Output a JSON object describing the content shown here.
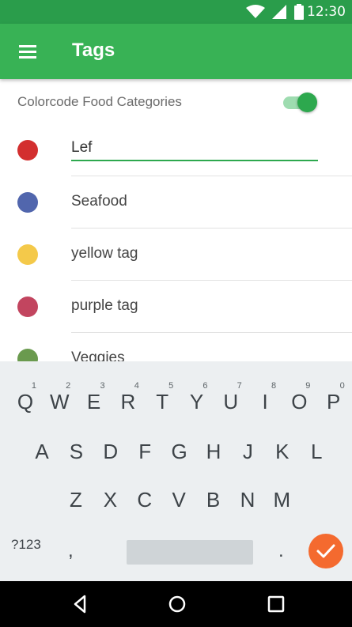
{
  "status_bar": {
    "time": "12:30"
  },
  "app_bar": {
    "title": "Tags"
  },
  "colorcode": {
    "label": "Colorcode Food Categories",
    "enabled": true
  },
  "tags": [
    {
      "name": "Lef",
      "color": "#d32f2f",
      "editing": true
    },
    {
      "name": "Seafood",
      "color": "#5166ad"
    },
    {
      "name": "yellow tag",
      "color": "#f4c94a"
    },
    {
      "name": "purple tag",
      "color": "#c2455f"
    },
    {
      "name": "Veggies",
      "color": "#6a9a4e"
    }
  ],
  "keyboard": {
    "row1": [
      {
        "key": "Q",
        "hint": "1"
      },
      {
        "key": "W",
        "hint": "2"
      },
      {
        "key": "E",
        "hint": "3"
      },
      {
        "key": "R",
        "hint": "4"
      },
      {
        "key": "T",
        "hint": "5"
      },
      {
        "key": "Y",
        "hint": "6"
      },
      {
        "key": "U",
        "hint": "7"
      },
      {
        "key": "I",
        "hint": "8"
      },
      {
        "key": "O",
        "hint": "9"
      },
      {
        "key": "P",
        "hint": "0"
      }
    ],
    "row2": [
      "A",
      "S",
      "D",
      "F",
      "G",
      "H",
      "J",
      "K",
      "L"
    ],
    "row3": [
      "Z",
      "X",
      "C",
      "V",
      "B",
      "N",
      "M"
    ],
    "symbols_label": "?123",
    "comma": ",",
    "period": ".",
    "enter_icon": "check-icon"
  },
  "nav_bar": {
    "buttons": [
      "back-icon",
      "home-icon",
      "recents-icon"
    ]
  },
  "colors": {
    "status_bar": "#2a9d4b",
    "app_bar": "#38b255",
    "accent": "#2da84e",
    "enter_key": "#f46a2f"
  }
}
